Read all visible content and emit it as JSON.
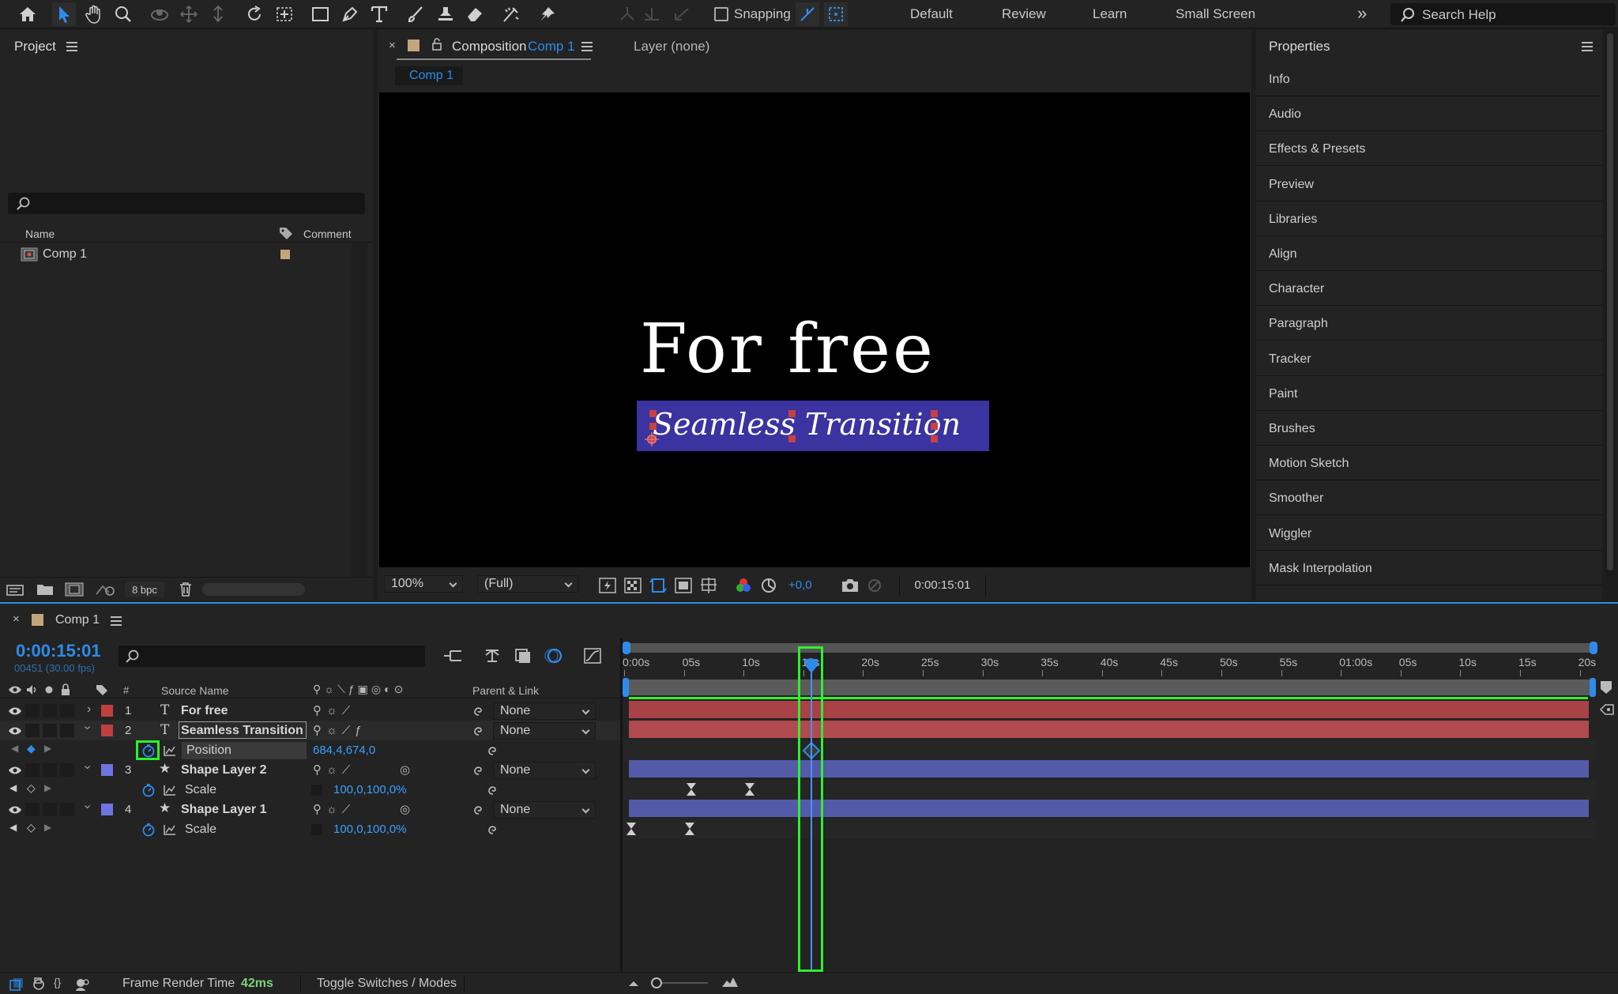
{
  "toolbar": {
    "snapping_label": "Snapping",
    "workspaces": [
      "Default",
      "Review",
      "Learn",
      "Small Screen"
    ],
    "search_placeholder": "Search Help"
  },
  "project": {
    "title": "Project",
    "columns": {
      "name": "Name",
      "comment": "Comment"
    },
    "items": [
      {
        "name": "Comp 1"
      }
    ],
    "bpc": "8 bpc"
  },
  "composition": {
    "tab_prefix": "Composition",
    "tab_name": "Comp 1",
    "layer_tab": "Layer (none)",
    "breadcrumb": "Comp 1",
    "zoom": "100%",
    "resolution": "(Full)",
    "exposure": "+0,0",
    "timecode": "0:00:15:01",
    "headline": "For free",
    "subtitle": "Seamless Transition"
  },
  "properties": {
    "title": "Properties",
    "items": [
      "Info",
      "Audio",
      "Effects & Presets",
      "Preview",
      "Libraries",
      "Align",
      "Character",
      "Paragraph",
      "Tracker",
      "Paint",
      "Brushes",
      "Motion Sketch",
      "Smoother",
      "Wiggler",
      "Mask Interpolation"
    ]
  },
  "timeline": {
    "comp_name": "Comp 1",
    "timecode": "0:00:15:01",
    "frame_info": "00451 (30.00 fps)",
    "headers": {
      "num": "#",
      "source": "Source Name",
      "parent": "Parent & Link"
    },
    "layers": [
      {
        "num": "1",
        "name": "For free",
        "type": "T",
        "parent": "None",
        "color": "#c0403f"
      },
      {
        "num": "2",
        "name": "Seamless Transition",
        "type": "T",
        "parent": "None",
        "color": "#c0403f"
      },
      {
        "num": "3",
        "name": "Shape Layer 2",
        "type": "★",
        "parent": "None",
        "color": "#6f74e0"
      },
      {
        "num": "4",
        "name": "Shape Layer 1",
        "type": "★",
        "parent": "None",
        "color": "#6f74e0"
      }
    ],
    "props": {
      "position": {
        "name": "Position",
        "value": "684,4,674,0"
      },
      "scale2": {
        "name": "Scale",
        "value": "100,0,100,0%"
      },
      "scale1": {
        "name": "Scale",
        "value": "100,0,100,0%"
      }
    },
    "ruler": [
      "0:00s",
      "05s",
      "10s",
      "15s",
      "20s",
      "25s",
      "30s",
      "35s",
      "40s",
      "45s",
      "50s",
      "55s",
      "01:00s",
      "05s",
      "10s",
      "15s",
      "20s"
    ],
    "status": {
      "frame_render_label": "Frame Render Time",
      "frame_render_value": "42ms",
      "toggle_label": "Toggle Switches / Modes"
    }
  },
  "colors": {
    "accent_blue": "#2d8ceb",
    "highlight_green": "#2ef02e",
    "text_bar_red": "#a84246",
    "shape_bar_blue": "#535aa8"
  }
}
